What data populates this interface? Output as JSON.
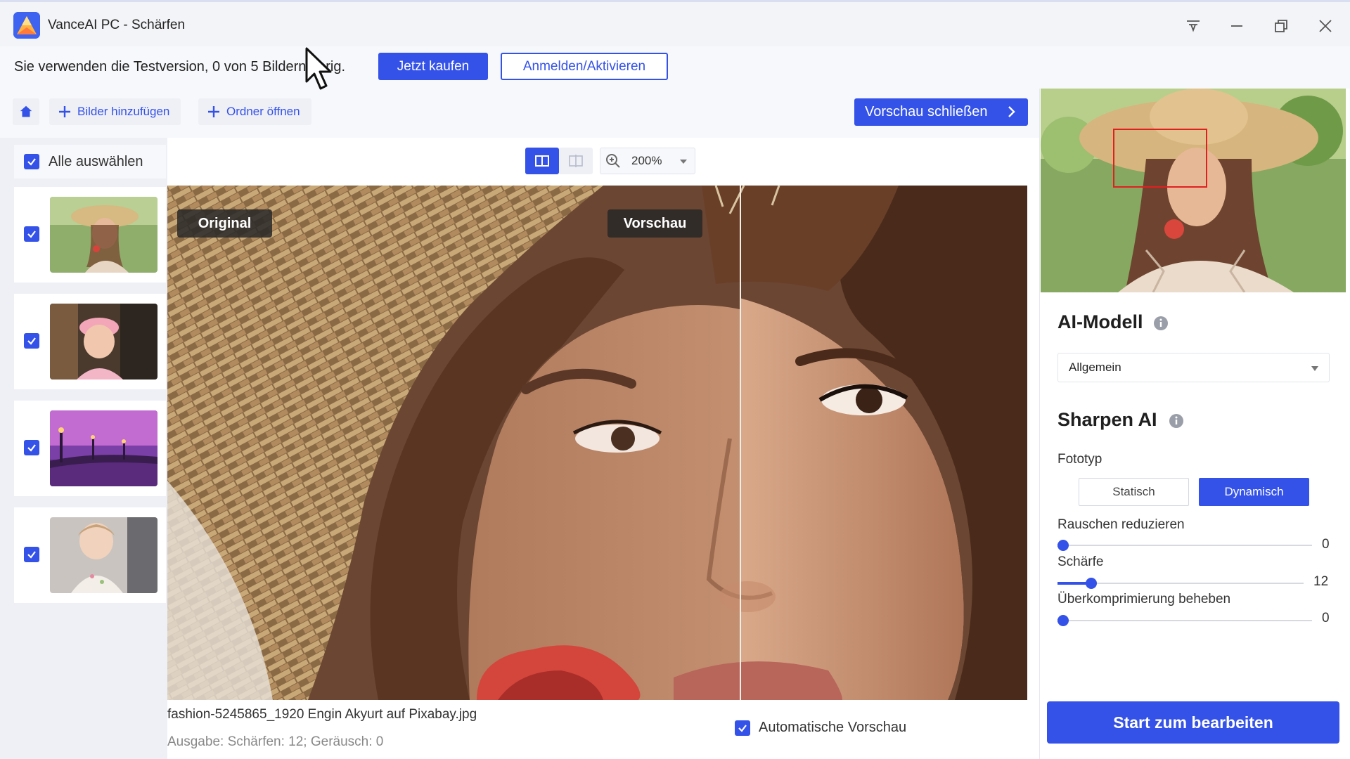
{
  "window": {
    "title": "VanceAI PC - Schärfen"
  },
  "trial": {
    "message": "Sie verwenden die Testversion, 0 von 5 Bildern übrig.",
    "buy_label": "Jetzt kaufen",
    "login_label": "Anmelden/Aktivieren"
  },
  "toolbar": {
    "add_images_label": "Bilder hinzufügen",
    "open_folder_label": "Ordner öffnen",
    "close_preview_label": "Vorschau schließen"
  },
  "sidebar": {
    "select_all_label": "Alle auswählen",
    "select_all_checked": true,
    "items": [
      {
        "name": "hat-woman",
        "checked": true
      },
      {
        "name": "child-pink-cap",
        "checked": true
      },
      {
        "name": "bridge-night",
        "checked": true
      },
      {
        "name": "toddler",
        "checked": true
      }
    ]
  },
  "view": {
    "zoom": "200%",
    "mode": "split"
  },
  "preview": {
    "original_label": "Original",
    "preview_label": "Vorschau",
    "filename": "fashion-5245865_1920 Engin Akyurt auf Pixabay.jpg",
    "output_info": "Ausgabe: Schärfen: 12; Geräusch: 0",
    "auto_preview_label": "Automatische Vorschau",
    "auto_preview_checked": true
  },
  "settings": {
    "ai_model_title": "AI-Modell",
    "ai_model_value": "Allgemein",
    "sharpen_title": "Sharpen AI",
    "photo_type_label": "Fototyp",
    "photo_type_options": [
      "Statisch",
      "Dynamisch"
    ],
    "photo_type_selected": "Dynamisch",
    "sliders": [
      {
        "label": "Rauschen reduzieren",
        "value": "0",
        "fraction": 0.0
      },
      {
        "label": "Schärfe",
        "value": "12",
        "fraction": 0.12
      },
      {
        "label": "Überkomprimierung beheben",
        "value": "0",
        "fraction": 0.0
      }
    ],
    "start_label": "Start zum bearbeiten"
  },
  "colors": {
    "accent": "#3452e8"
  }
}
